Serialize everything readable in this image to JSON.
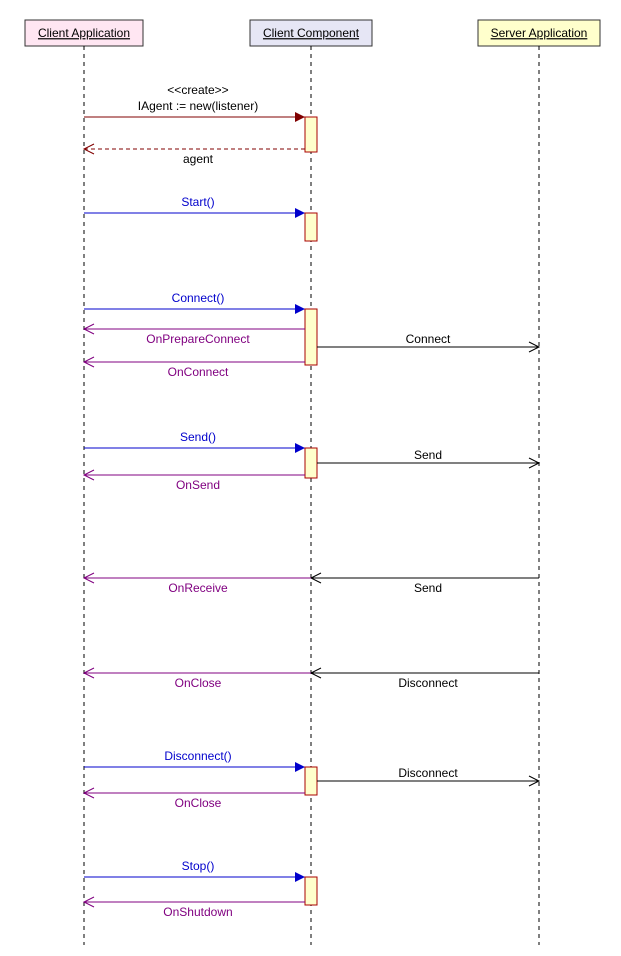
{
  "participants": {
    "client_app": "Client Application",
    "client_comp": "Client Component",
    "server_app": "Server Application"
  },
  "messages": {
    "create_stereo": "<<create>>",
    "create_label": "IAgent := new(listener)",
    "create_return": "agent",
    "start": "Start()",
    "connect": "Connect()",
    "on_prepare_connect": "OnPrepareConnect",
    "connect_to_server": "Connect",
    "on_connect": "OnConnect",
    "send": "Send()",
    "send_to_server": "Send",
    "on_send": "OnSend",
    "server_send": "Send",
    "on_receive": "OnReceive",
    "server_disconnect": "Disconnect",
    "on_close1": "OnClose",
    "disconnect": "Disconnect()",
    "disconnect_to_server": "Disconnect",
    "on_close2": "OnClose",
    "stop": "Stop()",
    "on_shutdown": "OnShutdown"
  },
  "colors": {
    "client_app_fill": "#ffe6f2",
    "client_comp_fill": "#e6e6f5",
    "server_app_fill": "#ffffcc"
  }
}
